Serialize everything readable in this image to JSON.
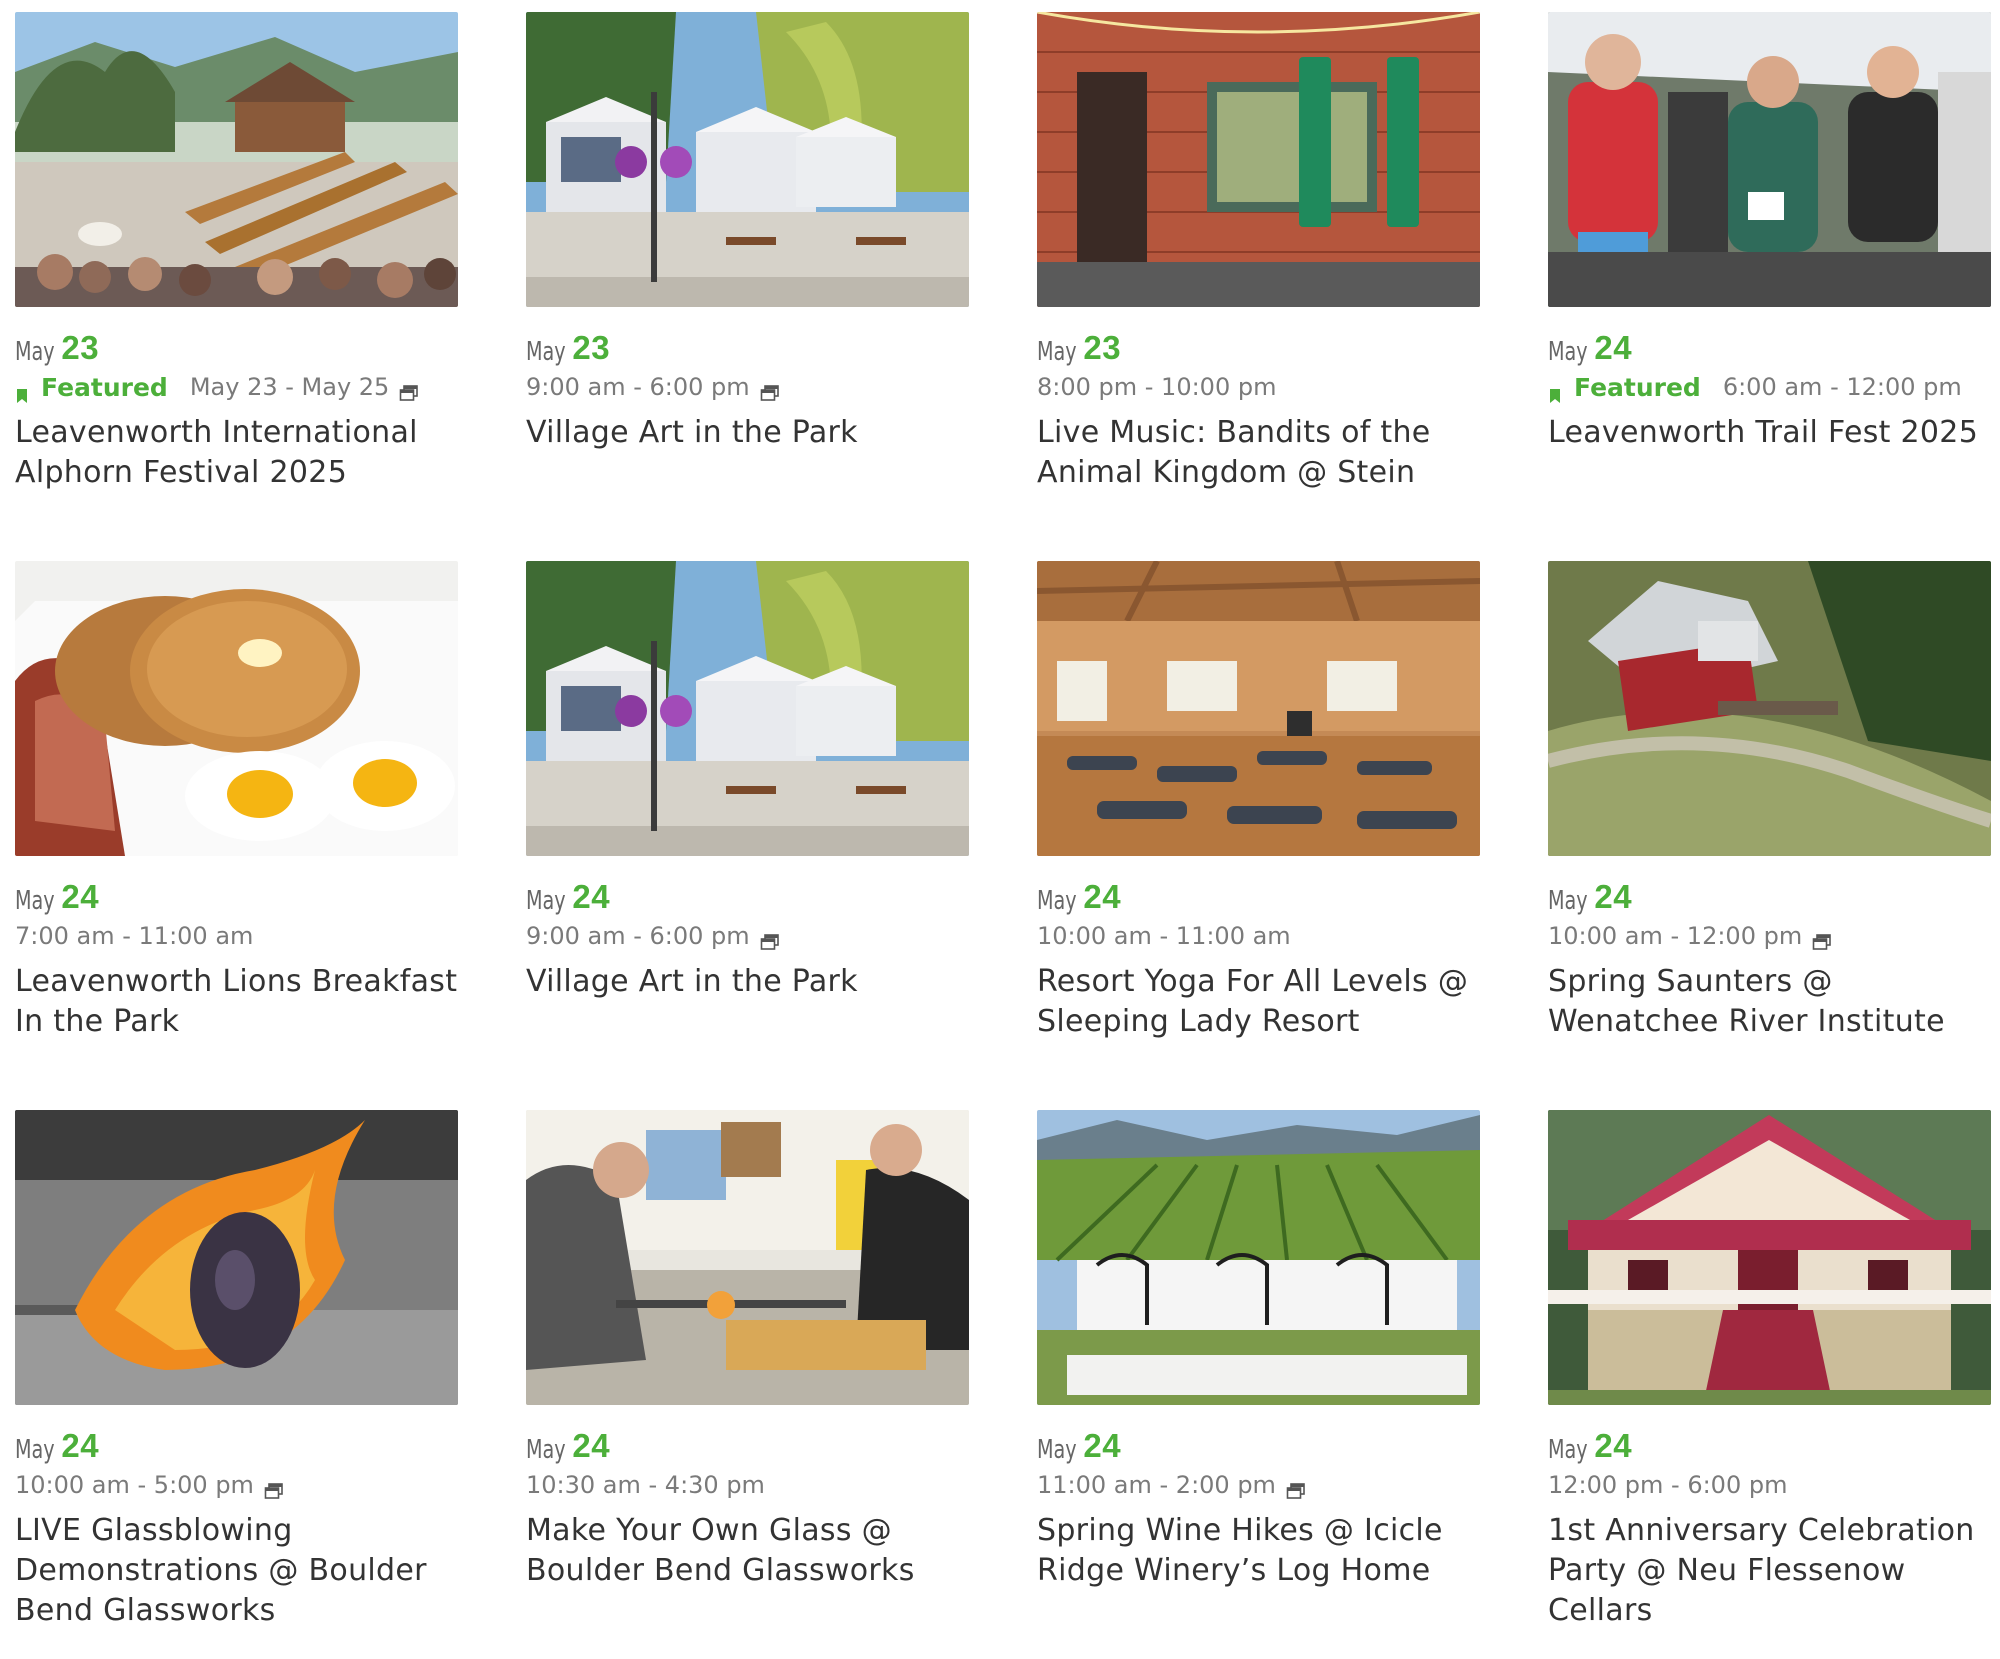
{
  "events": [
    {
      "month": "May",
      "day": "23",
      "featured": true,
      "featured_label": "Featured",
      "time": "May 23 - May 25",
      "recurring": true,
      "title": "Leavenworth International Alphorn Festival 2025",
      "image": "alphorn-festival-photo"
    },
    {
      "month": "May",
      "day": "23",
      "featured": false,
      "featured_label": "",
      "time": "9:00 am - 6:00 pm",
      "recurring": true,
      "title": "Village Art in the Park",
      "image": "art-tents-photo"
    },
    {
      "month": "May",
      "day": "23",
      "featured": false,
      "featured_label": "",
      "time": "8:00 pm - 10:00 pm",
      "recurring": false,
      "title": "Live Music: Bandits of the Animal Kingdom @ Stein",
      "image": "stein-storefront-photo"
    },
    {
      "month": "May",
      "day": "24",
      "featured": true,
      "featured_label": "Featured",
      "time": "6:00 am - 12:00 pm",
      "recurring": false,
      "title": "Leavenworth Trail Fest 2025",
      "image": "trail-runners-photo"
    },
    {
      "month": "May",
      "day": "24",
      "featured": false,
      "featured_label": "",
      "time": "7:00 am - 11:00 am",
      "recurring": false,
      "title": "Leavenworth Lions Breakfast In the Park",
      "image": "pancakes-eggs-photo"
    },
    {
      "month": "May",
      "day": "24",
      "featured": false,
      "featured_label": "",
      "time": "9:00 am - 6:00 pm",
      "recurring": true,
      "title": "Village Art in the Park",
      "image": "art-tents-photo"
    },
    {
      "month": "May",
      "day": "24",
      "featured": false,
      "featured_label": "",
      "time": "10:00 am - 11:00 am",
      "recurring": false,
      "title": "Resort Yoga For All Levels @ Sleeping Lady Resort",
      "image": "yoga-studio-photo"
    },
    {
      "month": "May",
      "day": "24",
      "featured": false,
      "featured_label": "",
      "time": "10:00 am - 12:00 pm",
      "recurring": true,
      "title": "Spring Saunters @ Wenatchee River Institute",
      "image": "red-barn-aerial-photo"
    },
    {
      "month": "May",
      "day": "24",
      "featured": false,
      "featured_label": "",
      "time": "10:00 am - 5:00 pm",
      "recurring": true,
      "title": "LIVE Glassblowing Demonstrations @ Boulder Bend Glassworks",
      "image": "glass-fire-photo"
    },
    {
      "month": "May",
      "day": "24",
      "featured": false,
      "featured_label": "",
      "time": "10:30 am - 4:30 pm",
      "recurring": false,
      "title": "Make Your Own Glass @ Boulder Bend Glassworks",
      "image": "glass-workshop-photo"
    },
    {
      "month": "May",
      "day": "24",
      "featured": false,
      "featured_label": "",
      "time": "11:00 am - 2:00 pm",
      "recurring": true,
      "title": "Spring Wine Hikes @ Icicle Ridge Winery’s Log Home",
      "image": "vineyard-table-photo"
    },
    {
      "month": "May",
      "day": "24",
      "featured": false,
      "featured_label": "",
      "time": "12:00 pm - 6:00 pm",
      "recurring": false,
      "title": "1st Anniversary Celebration Party @ Neu Flessenow Cellars",
      "image": "pink-house-photo"
    }
  ],
  "colors": {
    "accent": "#4caf3a",
    "meta": "#7a7a7a",
    "title": "#333333"
  }
}
